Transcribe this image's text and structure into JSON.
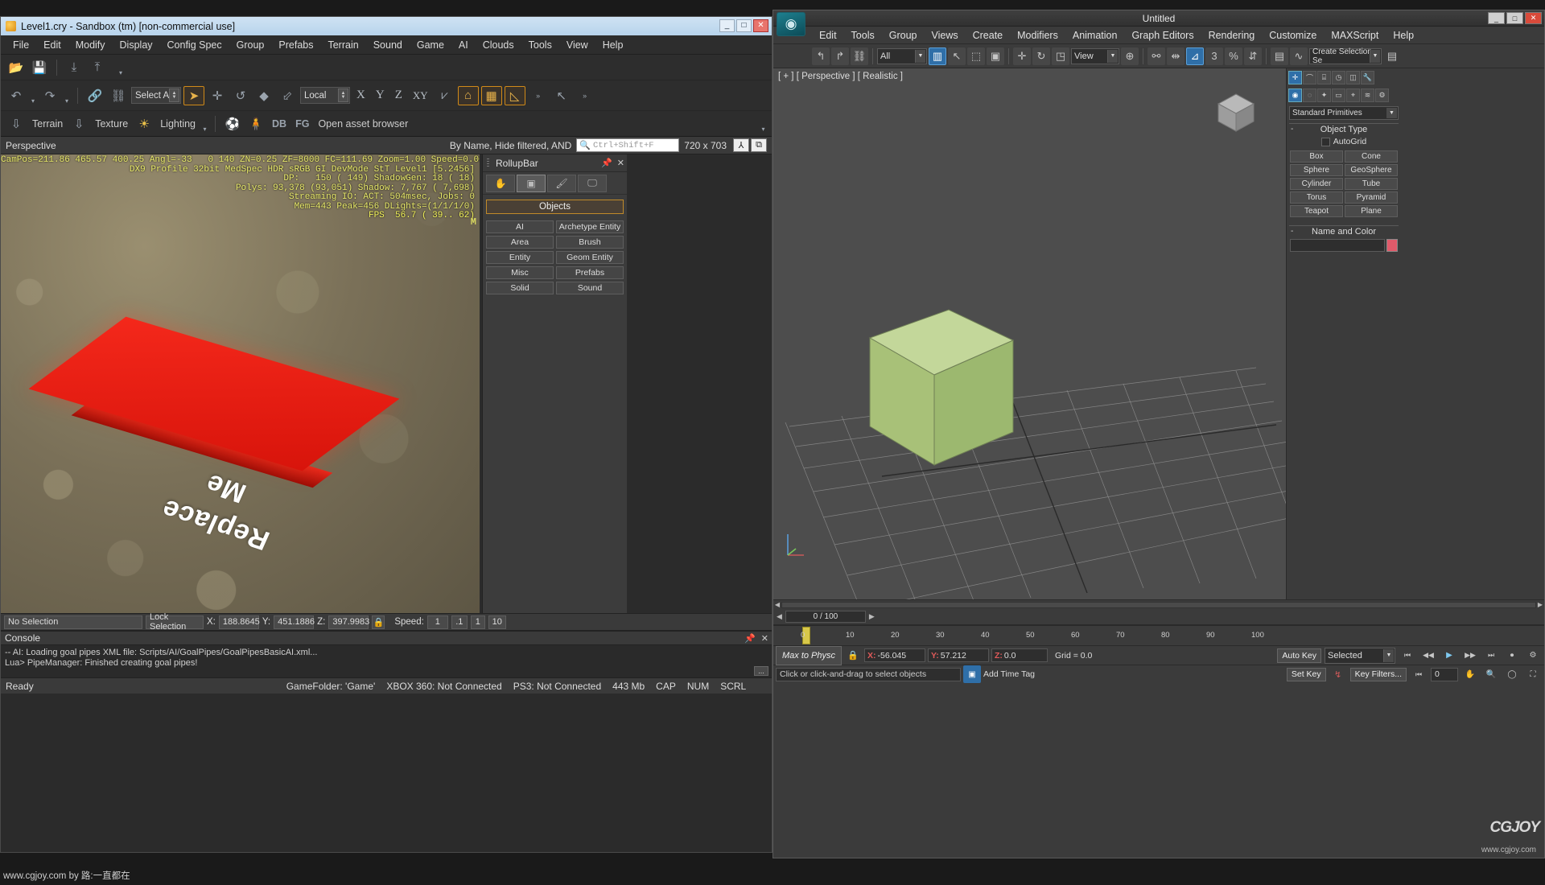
{
  "sandbox": {
    "title": "Level1.cry - Sandbox (tm) [non-commercial use]",
    "window_buttons": [
      "_",
      "□",
      "✕"
    ],
    "menu": [
      "File",
      "Edit",
      "Modify",
      "Display",
      "Config Spec",
      "Group",
      "Prefabs",
      "Terrain",
      "Sound",
      "Game",
      "AI",
      "Clouds",
      "Tools",
      "View",
      "Help"
    ],
    "toolbar_file": [
      "open-icon",
      "save-icon",
      "export-icon",
      "import-icon"
    ],
    "edit_toolbar": {
      "undo": "undo-icon",
      "redo": "redo-icon",
      "link": "link-icon",
      "unlink": "unlink-icon",
      "select_mode": "Select All",
      "select_tool": "arrow-select-icon",
      "move_tool": "move-icon",
      "rotate_tool": "rotate-icon",
      "scale_tool": "scale-icon",
      "terrain_snap": "terrain-snap-icon",
      "coord_space": "Local",
      "axis_x": "X",
      "axis_y": "Y",
      "axis_z": "Z",
      "axis_xy": "XY",
      "axis_terrain": "terrain-axis-icon",
      "goto_pos": "goto-position-icon",
      "grid_snap": "grid-snap-icon",
      "angle_snap": "angle-snap-icon"
    },
    "tools_row": {
      "terrain": "Terrain",
      "texture": "Texture",
      "lighting": "Lighting",
      "asset_browser": "Open asset browser",
      "db_label": "DB",
      "fg_label": "FG"
    },
    "viewport": {
      "name": "Perspective",
      "filter_label": "By Name, Hide filtered, AND",
      "search_placeholder": "Ctrl+Shift+F",
      "resolution": "720 x 703",
      "hud_lines": [
        "CamPos=211.86 465.57 400.25 Angl=-33   0 140 ZN=0.25 ZF=8000 FC=111.69 Zoom=1.00 Speed=0.00",
        "                  DX9 Profile 32bit MedSpec HDR sRGB GI DevMode StT Level1 [5.2456]",
        "                                      DP:   150 ( 149) ShadowGen: 18 ( 18)",
        "                         Polys: 93,378 (93,051) Shadow: 7,767 ( 7,698)",
        "                          Streaming IO: ACT: 504msec, Jobs: 0",
        "                              Mem=443 Peak=456 DLights=(1/1/1/0)",
        "                                        FPS  56.7 ( 39.. 62)"
      ],
      "mem_badge": "M",
      "object_text_line1": "Replace",
      "object_text_line2": "Me"
    },
    "viewport_status": {
      "no_selection": "No Selection",
      "lock_selection": "Lock Selection",
      "x_label": "X:",
      "x_value": "188.8645",
      "y_label": "Y:",
      "y_value": "451.1886",
      "z_label": "Z:",
      "z_value": "397.9983",
      "lock_icon": "lock-icon",
      "speed_label": "Speed:",
      "speed_value": "1",
      "speed_presets": [
        ".1",
        "1",
        "10"
      ]
    },
    "rollup": {
      "title": "RollupBar",
      "tabs": [
        "hand-icon",
        "cube-icon",
        "brush-icon",
        "display-icon"
      ],
      "section": "Objects",
      "buttons": [
        "AI",
        "Archetype Entity",
        "Area",
        "Brush",
        "Entity",
        "Geom Entity",
        "Misc",
        "Prefabs",
        "Solid",
        "Sound"
      ]
    },
    "console": {
      "title": "Console",
      "lines": [
        "-- AI: Loading goal pipes XML file: Scripts/AI/GoalPipes/GoalPipesBasicAI.xml...",
        "Lua> PipeManager: Finished creating goal pipes!"
      ],
      "more_button": "..."
    },
    "status_bar": {
      "ready": "Ready",
      "gamefolder": "GameFolder: 'Game'",
      "xbox": "XBOX 360: Not Connected",
      "ps3": "PS3: Not Connected",
      "mem": "443 Mb",
      "cap": "CAP",
      "num": "NUM",
      "scrl": "SCRL"
    }
  },
  "max": {
    "title": "Untitled",
    "window_buttons": [
      "_",
      "□",
      "✕"
    ],
    "logo": "max-logo-icon",
    "menu": [
      "Edit",
      "Tools",
      "Group",
      "Views",
      "Create",
      "Modifiers",
      "Animation",
      "Graph Editors",
      "Rendering",
      "Customize",
      "MAXScript",
      "Help"
    ],
    "toolbar": {
      "undo": "undo-curve-icon",
      "redo": "redo-curve-icon",
      "link": "select-link-icon",
      "filter": "All",
      "select_object": "select-object-icon",
      "select_name": "select-by-name-icon",
      "rect_region": "rectangular-select-region-icon",
      "window_crossing": "window-crossing-icon",
      "select_move": "select-and-move-icon",
      "select_rotate": "select-and-rotate-icon",
      "select_scale": "select-and-scale-icon",
      "ref_coord_system": "View",
      "use_center": "use-pivot-center-icon",
      "select_link2": "select-and-link-icon",
      "snap_toggle": "snaps-toggle-icon",
      "angle_snap": "angle-snap-icon",
      "percent_snap": "percent-snap-icon",
      "spinner_snap": "spinner-snap-icon",
      "named_set": "Create Selection Se",
      "mirror": "mirror-icon",
      "align": "align-icon",
      "layer_manager": "layer-manager-icon",
      "curve_editor": "curve-editor-icon",
      "schematic": "schematic-view-icon"
    },
    "viewport": {
      "label": "[ + ] [ Perspective ] [ Realistic ]",
      "viewcube": "view-cube-icon",
      "axis_tripod": "axis-tripod-icon"
    },
    "panel": {
      "tabs": [
        "create-icon",
        "modify-icon",
        "hierarchy-icon",
        "motion-icon",
        "display-icon",
        "utilities-icon"
      ],
      "category_icons": [
        "geometry-icon",
        "shapes-icon",
        "lights-icon",
        "cameras-icon",
        "helpers-icon",
        "space-warps-icon",
        "systems-icon"
      ],
      "category": "Standard Primitives",
      "object_type_header": "Object Type",
      "autogrid_label": "AutoGrid",
      "object_buttons": [
        "Box",
        "Cone",
        "Sphere",
        "GeoSphere",
        "Cylinder",
        "Tube",
        "Torus",
        "Pyramid",
        "Teapot",
        "Plane"
      ],
      "name_color_header": "Name and Color",
      "color_swatch": "#e05a6a"
    },
    "timeline": {
      "frame_display": "0 / 100",
      "ticks": [
        "0",
        "10",
        "20",
        "30",
        "40",
        "50",
        "60",
        "70",
        "80",
        "90",
        "100"
      ]
    },
    "status": {
      "max_to_physx": "Max to Physc",
      "prompt": "Click or click-and-drag to select objects",
      "add_time_tag": "Add Time Tag",
      "x_label": "X:",
      "x_value": "-56.045",
      "y_label": "Y:",
      "y_value": "57.212",
      "z_label": "Z:",
      "z_value": "0.0",
      "grid_label": "Grid = 0.0",
      "auto_key": "Auto Key",
      "set_key": "Set Key",
      "selected": "Selected",
      "key_filters": "Key Filters...",
      "frame_field": "0"
    },
    "cgjoy_logo": "CGJOY"
  },
  "watermark": {
    "left": "www.cgjoy.com by 路:一直都在",
    "right": "www.cgjoy.com"
  }
}
